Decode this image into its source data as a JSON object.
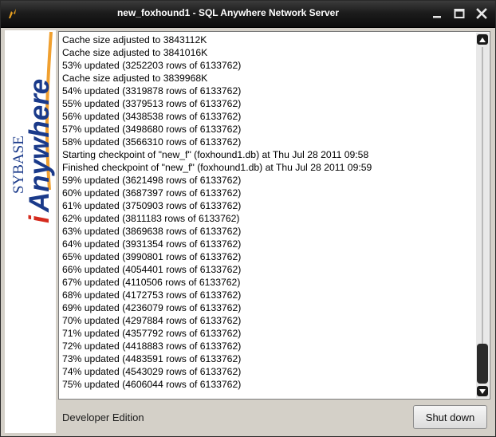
{
  "window": {
    "title": "new_foxhound1 - SQL Anywhere Network Server",
    "controls": [
      "minimize-icon",
      "maximize-icon",
      "close-icon"
    ]
  },
  "logo": {
    "brand": "SYBASE",
    "product_prefix": "i",
    "product": "Anywhere",
    "colors": {
      "brand": "#1a3a8a",
      "accent": "#d52b1e",
      "swoosh": "#f0a030"
    }
  },
  "log": {
    "lines": [
      "Cache size adjusted to 3843112K",
      "Cache size adjusted to 3841016K",
      "53% updated (3252203 rows of 6133762)",
      "Cache size adjusted to 3839968K",
      "54% updated (3319878 rows of 6133762)",
      "55% updated (3379513 rows of 6133762)",
      "56% updated (3438538 rows of 6133762)",
      "57% updated (3498680 rows of 6133762)",
      "58% updated (3566310 rows of 6133762)",
      "Starting checkpoint of \"new_f\" (foxhound1.db) at Thu Jul 28 2011 09:58",
      "Finished checkpoint of \"new_f\" (foxhound1.db) at Thu Jul 28 2011 09:59",
      "59% updated (3621498 rows of 6133762)",
      "60% updated (3687397 rows of 6133762)",
      "61% updated (3750903 rows of 6133762)",
      "62% updated (3811183 rows of 6133762)",
      "63% updated (3869638 rows of 6133762)",
      "64% updated (3931354 rows of 6133762)",
      "65% updated (3990801 rows of 6133762)",
      "66% updated (4054401 rows of 6133762)",
      "67% updated (4110506 rows of 6133762)",
      "68% updated (4172753 rows of 6133762)",
      "69% updated (4236079 rows of 6133762)",
      "70% updated (4297884 rows of 6133762)",
      "71% updated (4357792 rows of 6133762)",
      "72% updated (4418883 rows of 6133762)",
      "73% updated (4483591 rows of 6133762)",
      "74% updated (4543029 rows of 6133762)",
      "75% updated (4606044 rows of 6133762)"
    ],
    "scroll_position": 1.0
  },
  "footer": {
    "edition": "Developer Edition",
    "shutdown_label": "Shut down"
  }
}
